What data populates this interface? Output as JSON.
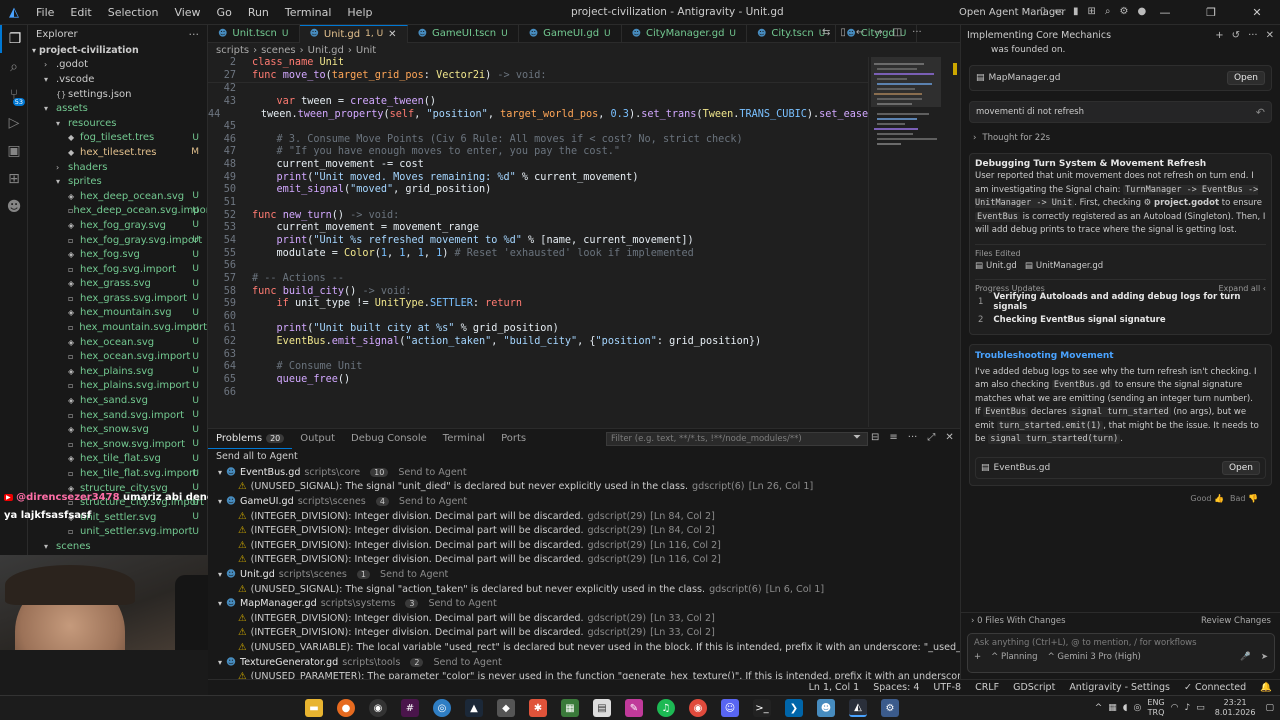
{
  "titlebar": {
    "menu": [
      "File",
      "Edit",
      "Selection",
      "View",
      "Go",
      "Run",
      "Terminal",
      "Help"
    ],
    "title": "project-civilization - Antigravity - Unit.gd",
    "open_agent_manager": "Open Agent Manager"
  },
  "explorer": {
    "header": "Explorer",
    "root": "project-civilization",
    "items": [
      {
        "label": ".godot",
        "indent": 1,
        "type": "folder-closed",
        "badge": ""
      },
      {
        "label": ".vscode",
        "indent": 1,
        "type": "folder-open",
        "badge": ""
      },
      {
        "label": "settings.json",
        "indent": 2,
        "type": "json",
        "badge": ""
      },
      {
        "label": "assets",
        "indent": 1,
        "type": "folder-open",
        "badge": "",
        "git": "u"
      },
      {
        "label": "resources",
        "indent": 2,
        "type": "folder-open",
        "badge": "",
        "git": "u"
      },
      {
        "label": "fog_tileset.tres",
        "indent": 3,
        "type": "tres",
        "badge": "U",
        "git": "u"
      },
      {
        "label": "hex_tileset.tres",
        "indent": 3,
        "type": "tres",
        "badge": "M",
        "git": "m"
      },
      {
        "label": "shaders",
        "indent": 2,
        "type": "folder-closed",
        "badge": "",
        "git": "u"
      },
      {
        "label": "sprites",
        "indent": 2,
        "type": "folder-open",
        "badge": "",
        "git": "u"
      },
      {
        "label": "hex_deep_ocean.svg",
        "indent": 3,
        "type": "svg",
        "badge": "U",
        "git": "u"
      },
      {
        "label": "hex_deep_ocean.svg.import",
        "indent": 3,
        "type": "import",
        "badge": "U",
        "git": "u"
      },
      {
        "label": "hex_fog_gray.svg",
        "indent": 3,
        "type": "svg",
        "badge": "U",
        "git": "u"
      },
      {
        "label": "hex_fog_gray.svg.import",
        "indent": 3,
        "type": "import",
        "badge": "U",
        "git": "u"
      },
      {
        "label": "hex_fog.svg",
        "indent": 3,
        "type": "svg",
        "badge": "U",
        "git": "u"
      },
      {
        "label": "hex_fog.svg.import",
        "indent": 3,
        "type": "import",
        "badge": "U",
        "git": "u"
      },
      {
        "label": "hex_grass.svg",
        "indent": 3,
        "type": "svg",
        "badge": "U",
        "git": "u"
      },
      {
        "label": "hex_grass.svg.import",
        "indent": 3,
        "type": "import",
        "badge": "U",
        "git": "u"
      },
      {
        "label": "hex_mountain.svg",
        "indent": 3,
        "type": "svg",
        "badge": "U",
        "git": "u"
      },
      {
        "label": "hex_mountain.svg.import",
        "indent": 3,
        "type": "import",
        "badge": "U",
        "git": "u"
      },
      {
        "label": "hex_ocean.svg",
        "indent": 3,
        "type": "svg",
        "badge": "U",
        "git": "u"
      },
      {
        "label": "hex_ocean.svg.import",
        "indent": 3,
        "type": "import",
        "badge": "U",
        "git": "u"
      },
      {
        "label": "hex_plains.svg",
        "indent": 3,
        "type": "svg",
        "badge": "U",
        "git": "u"
      },
      {
        "label": "hex_plains.svg.import",
        "indent": 3,
        "type": "import",
        "badge": "U",
        "git": "u"
      },
      {
        "label": "hex_sand.svg",
        "indent": 3,
        "type": "svg",
        "badge": "U",
        "git": "u"
      },
      {
        "label": "hex_sand.svg.import",
        "indent": 3,
        "type": "import",
        "badge": "U",
        "git": "u"
      },
      {
        "label": "hex_snow.svg",
        "indent": 3,
        "type": "svg",
        "badge": "U",
        "git": "u"
      },
      {
        "label": "hex_snow.svg.import",
        "indent": 3,
        "type": "import",
        "badge": "U",
        "git": "u"
      },
      {
        "label": "hex_tile_flat.svg",
        "indent": 3,
        "type": "svg",
        "badge": "U",
        "git": "u"
      },
      {
        "label": "hex_tile_flat.svg.import",
        "indent": 3,
        "type": "import",
        "badge": "U",
        "git": "u"
      },
      {
        "label": "structure_city.svg",
        "indent": 3,
        "type": "svg",
        "badge": "U",
        "git": "u"
      },
      {
        "label": "structure_city.svg.import",
        "indent": 3,
        "type": "import",
        "badge": "U",
        "git": "u"
      },
      {
        "label": "unit_settler.svg",
        "indent": 3,
        "type": "svg",
        "badge": "U",
        "git": "u"
      },
      {
        "label": "unit_settler.svg.import",
        "indent": 3,
        "type": "import",
        "badge": "U",
        "git": "u"
      },
      {
        "label": "scenes",
        "indent": 1,
        "type": "folder-open",
        "badge": "",
        "git": "u"
      }
    ]
  },
  "tabs": [
    {
      "label": "Unit.tscn",
      "status": "U",
      "active": false
    },
    {
      "label": "Unit.gd",
      "status": "1, U",
      "active": true
    },
    {
      "label": "GameUI.tscn",
      "status": "U",
      "active": false
    },
    {
      "label": "GameUI.gd",
      "status": "U",
      "active": false
    },
    {
      "label": "CityManager.gd",
      "status": "U",
      "active": false
    },
    {
      "label": "City.tscn",
      "status": "U",
      "active": false
    },
    {
      "label": "City.gd",
      "status": "U",
      "active": false
    }
  ],
  "breadcrumb": [
    "scripts",
    "scenes",
    "Unit.gd",
    "Unit"
  ],
  "editor": {
    "sticky": [
      {
        "n": "2",
        "html": "<span class='kw'>class_name</span> <span class='ty'>Unit</span>"
      },
      {
        "n": "27",
        "html": "<span class='kw'>func</span> <span class='fn'>move_to</span>(<span class='ivar'>target_grid_pos</span>: <span class='ty'>Vector2i</span>) <span class='cm'>-&gt; void:</span>"
      }
    ],
    "lines": [
      {
        "n": "42",
        "html": ""
      },
      {
        "n": "43",
        "html": "    <span class='kw'>var</span> <span class='id'>tween</span> = <span class='fn'>create_tween</span>()"
      },
      {
        "n": "44",
        "html": "    <span class='id'>tween</span>.<span class='fn'>tween_property</span>(<span class='kw'>self</span>, <span class='str'>\"position\"</span>, <span class='ivar'>target_world_pos</span>, <span class='num'>0.3</span>).<span class='fn'>set_trans</span>(<span class='ty'>Tween</span>.<span class='num'>TRANS_CUBIC</span>).<span class='fn'>set_ease</span>(<span class='ty'>Tween</span>.<span class='num'>EASE_OUT</span>)"
      },
      {
        "n": "45",
        "html": ""
      },
      {
        "n": "46",
        "html": "    <span class='cm'># 3. Consume Move Points (Civ 6 Rule: All moves if &lt; cost? No, strict check)</span>"
      },
      {
        "n": "47",
        "html": "    <span class='cm'># \"If you have enough moves to enter, you pay the cost.\"</span>"
      },
      {
        "n": "48",
        "html": "    <span class='id'>current_movement</span> -= <span class='id'>cost</span>"
      },
      {
        "n": "49",
        "html": "    <span class='fn'>print</span>(<span class='str'>\"Unit moved. Moves remaining: %d\"</span> % <span class='id'>current_movement</span>)"
      },
      {
        "n": "50",
        "html": "    <span class='fn'>emit_signal</span>(<span class='str'>\"moved\"</span>, <span class='id'>grid_position</span>)"
      },
      {
        "n": "51",
        "html": ""
      },
      {
        "n": "52",
        "html": "<span class='kw'>func</span> <span class='fn'>new_turn</span>() <span class='cm'>-&gt; void:</span>"
      },
      {
        "n": "53",
        "html": "    <span class='id'>current_movement</span> = <span class='id'>movement_range</span>"
      },
      {
        "n": "54",
        "html": "    <span class='fn'>print</span>(<span class='str'>\"Unit %s refreshed movement to %d\"</span> % [<span class='id'>name</span>, <span class='id'>current_movement</span>])"
      },
      {
        "n": "55",
        "html": "    <span class='id'>modulate</span> = <span class='ty'>Color</span>(<span class='num'>1</span>, <span class='num'>1</span>, <span class='num'>1</span>, <span class='num'>1</span>) <span class='cm'># Reset 'exhausted' look if implemented</span>"
      },
      {
        "n": "56",
        "html": ""
      },
      {
        "n": "57",
        "html": "<span class='cm'># -- Actions --</span>"
      },
      {
        "n": "58",
        "html": "<span class='kw'>func</span> <span class='fn'>build_city</span>() <span class='cm'>-&gt; void:</span>"
      },
      {
        "n": "59",
        "html": "    <span class='kw'>if</span> <span class='id'>unit_type</span> != <span class='ty'>UnitType</span>.<span class='num'>SETTLER</span>: <span class='kw'>return</span>"
      },
      {
        "n": "60",
        "html": ""
      },
      {
        "n": "61",
        "html": "    <span class='fn'>print</span>(<span class='str'>\"Unit built city at %s\"</span> % <span class='id'>grid_position</span>)"
      },
      {
        "n": "62",
        "html": "    <span class='ty'>EventBus</span>.<span class='fn'>emit_signal</span>(<span class='str'>\"action_taken\"</span>, <span class='str'>\"build_city\"</span>, {<span class='str'>\"position\"</span>: <span class='id'>grid_position</span>})"
      },
      {
        "n": "63",
        "html": ""
      },
      {
        "n": "64",
        "html": "    <span class='cm'># Consume Unit</span>"
      },
      {
        "n": "65",
        "html": "    <span class='fn'>queue_free</span>()"
      },
      {
        "n": "66",
        "html": ""
      }
    ]
  },
  "panel": {
    "tabs": [
      "Problems",
      "Output",
      "Debug Console",
      "Terminal",
      "Ports"
    ],
    "problems_count": "20",
    "filter_placeholder": "Filter (e.g. text, **/*.ts, !**/node_modules/**)",
    "send_all": "Send all to Agent",
    "rows": [
      {
        "kind": "file",
        "file": "EventBus.gd",
        "path": "scripts\\core",
        "count": "10",
        "action": "Send to Agent"
      },
      {
        "kind": "warn",
        "msg": "(UNUSED_SIGNAL): The signal \"unit_died\" is declared but never explicitly used in the class.",
        "src": "gdscript(6)",
        "loc": "[Ln 26, Col 1]"
      },
      {
        "kind": "file",
        "file": "GameUI.gd",
        "path": "scripts\\scenes",
        "count": "4",
        "action": "Send to Agent"
      },
      {
        "kind": "warn",
        "msg": "(INTEGER_DIVISION): Integer division. Decimal part will be discarded.",
        "src": "gdscript(29)",
        "loc": "[Ln 84, Col 2]"
      },
      {
        "kind": "warn",
        "msg": "(INTEGER_DIVISION): Integer division. Decimal part will be discarded.",
        "src": "gdscript(29)",
        "loc": "[Ln 84, Col 2]"
      },
      {
        "kind": "warn",
        "msg": "(INTEGER_DIVISION): Integer division. Decimal part will be discarded.",
        "src": "gdscript(29)",
        "loc": "[Ln 116, Col 2]"
      },
      {
        "kind": "warn",
        "msg": "(INTEGER_DIVISION): Integer division. Decimal part will be discarded.",
        "src": "gdscript(29)",
        "loc": "[Ln 116, Col 2]"
      },
      {
        "kind": "file",
        "file": "Unit.gd",
        "path": "scripts\\scenes",
        "count": "1",
        "action": "Send to Agent"
      },
      {
        "kind": "warn",
        "msg": "(UNUSED_SIGNAL): The signal \"action_taken\" is declared but never explicitly used in the class.",
        "src": "gdscript(6)",
        "loc": "[Ln 6, Col 1]"
      },
      {
        "kind": "file",
        "file": "MapManager.gd",
        "path": "scripts\\systems",
        "count": "3",
        "action": "Send to Agent"
      },
      {
        "kind": "warn",
        "msg": "(INTEGER_DIVISION): Integer division. Decimal part will be discarded.",
        "src": "gdscript(29)",
        "loc": "[Ln 33, Col 2]"
      },
      {
        "kind": "warn",
        "msg": "(INTEGER_DIVISION): Integer division. Decimal part will be discarded.",
        "src": "gdscript(29)",
        "loc": "[Ln 33, Col 2]"
      },
      {
        "kind": "warn",
        "msg": "(UNUSED_VARIABLE): The local variable \"used_rect\" is declared but never used in the block. If this is intended, prefix it with an underscore: \"_used_rect\".",
        "src": "gdscript(2)",
        "loc": "[Ln 45, Col 2]"
      },
      {
        "kind": "file",
        "file": "TextureGenerator.gd",
        "path": "scripts\\tools",
        "count": "2",
        "action": "Send to Agent"
      },
      {
        "kind": "warn",
        "msg": "(UNUSED_PARAMETER): The parameter \"color\" is never used in the function \"generate_hex_texture()\". If this is intended, prefix it with an underscore: \"_color\".",
        "src": "gdscript(5)",
        "loc": "[Ln 4, Col 1]"
      }
    ]
  },
  "agent": {
    "header": "Implementing Core Mechanics",
    "founded_text": "was founded on.",
    "file1": "MapManager.gd",
    "open": "Open",
    "user_msg": "movementi di not refresh",
    "thought": "Thought for 22s",
    "task1_title": "Debugging Turn System & Movement Refresh",
    "task1_p1": "User reported that unit movement does not refresh on turn end. I am investigating the Signal chain:",
    "task1_code1": "TurnManager -> EventBus -> UnitManager -> Unit",
    "task1_p2": ". First, checking",
    "task1_godot": "project.godot",
    "task1_p3": "to ensure",
    "task1_code2": "EventBus",
    "task1_p4": "is correctly registered as an Autoload (Singleton). Then, I will add debug prints to trace where the signal is getting lost.",
    "files_edited_label": "Files Edited",
    "files_edited": [
      "Unit.gd",
      "UnitManager.gd"
    ],
    "progress_label": "Progress Updates",
    "expand_all": "Expand all",
    "progress": [
      {
        "n": "1",
        "text": "Verifying Autoloads and adding debug logs for turn signals"
      },
      {
        "n": "2",
        "text": "Checking EventBus signal signature"
      }
    ],
    "task2_title": "Troubleshooting Movement",
    "task2_a": "I've added debug logs to see why the turn refresh isn't checking. I am also checking",
    "task2_code1": "EventBus.gd",
    "task2_b": "to ensure the signal signature matches what we are emitting (sending an integer turn number).",
    "task2_c": "If",
    "task2_code2": "EventBus",
    "task2_d": "declares",
    "task2_code3": "signal turn_started",
    "task2_e": "(no args), but we emit",
    "task2_code4": "turn_started.emit(1)",
    "task2_f": ", that might be the issue. It needs to be",
    "task2_code5": "signal turn_started(turn)",
    "task2_g": ".",
    "file2": "EventBus.gd",
    "good": "Good",
    "bad": "Bad",
    "files_with_changes": "0 Files With Changes",
    "review_changes": "Review Changes",
    "input_placeholder": "Ask anything (Ctrl+L), @ to mention, / for workflows",
    "planning": "Planning",
    "model": "Gemini 3 Pro (High)"
  },
  "statusbar": {
    "position": "Ln 1, Col 1",
    "spaces": "Spaces: 4",
    "encoding": "UTF-8",
    "eol": "CRLF",
    "lang": "GDScript",
    "settings": "Antigravity - Settings",
    "connected": "Connected"
  },
  "taskbar": {
    "lang_top": "ENG",
    "lang_bottom": "TRQ",
    "time": "23:21",
    "date": "8.01.2026"
  },
  "stream": {
    "chat_user": "@direncsezer3478",
    "chat_msg": "umariz abi denemeye devam",
    "chat_msg2": "ya lajkfsasfsasf"
  },
  "colors": {
    "accent": "#0078d4",
    "git_untracked": "#73c991",
    "git_modified": "#e2c08d",
    "warning": "#cca700"
  }
}
